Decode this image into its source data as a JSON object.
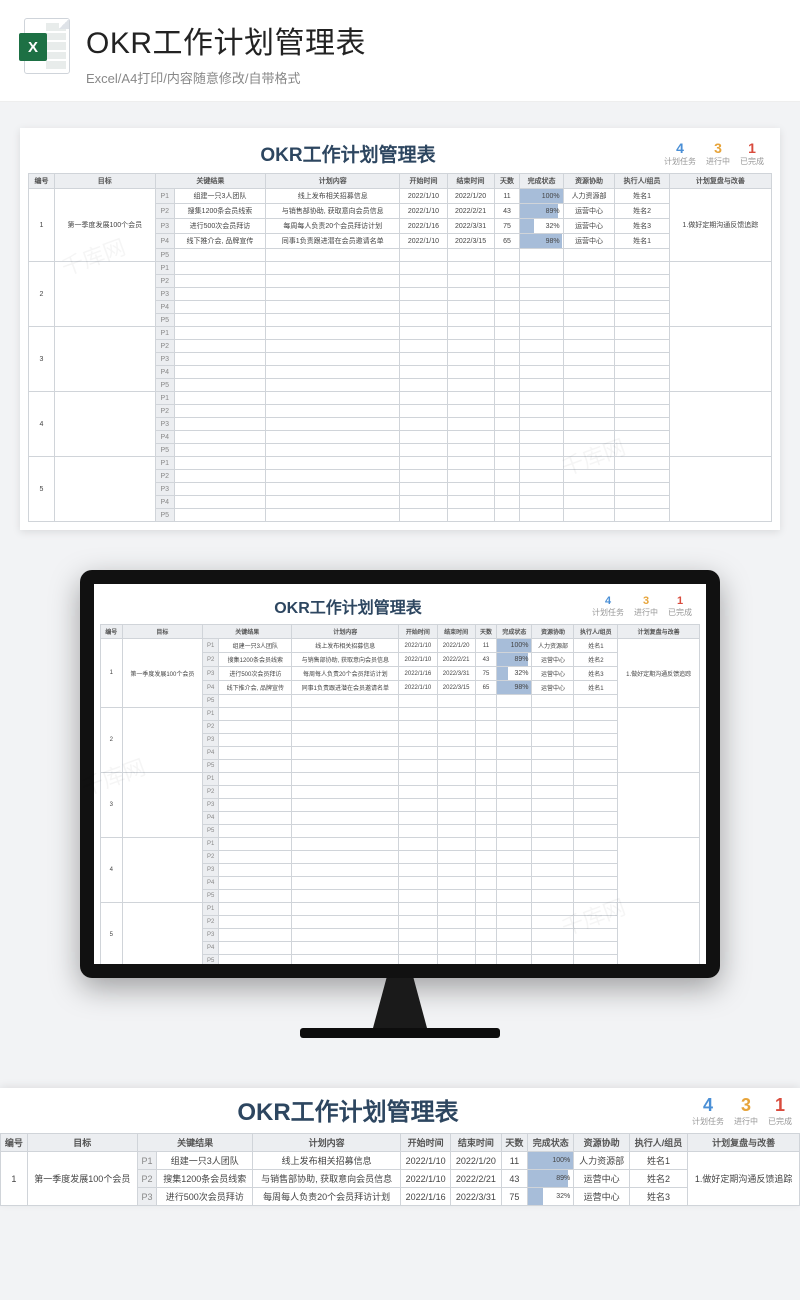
{
  "header": {
    "title": "OKR工作计划管理表",
    "subtitle": "Excel/A4打印/内容随意修改/自带格式",
    "icon_letter": "X"
  },
  "watermark": "千库网",
  "sheet": {
    "title": "OKR工作计划管理表",
    "stats": [
      {
        "num": "4",
        "label": "计划任务"
      },
      {
        "num": "3",
        "label": "进行中"
      },
      {
        "num": "1",
        "label": "已完成"
      }
    ],
    "columns": [
      "编号",
      "目标",
      "关键结果",
      "计划内容",
      "开始时间",
      "结束时间",
      "天数",
      "完成状态",
      "资源协助",
      "执行人/组员",
      "计划复盘与改善"
    ],
    "groups": [
      {
        "id": "1",
        "objective": "第一季度发展100个会员",
        "review": "1.做好定期沟通反馈追踪",
        "rows": [
          {
            "kr": "P1",
            "task": "组建一只3人团队",
            "plan": "线上发布相关招募信息",
            "start": "2022/1/10",
            "end": "2022/1/20",
            "days": "11",
            "pct": 100,
            "resource": "人力资源部",
            "owner": "姓名1"
          },
          {
            "kr": "P2",
            "task": "搜集1200条会员线索",
            "plan": "与销售部协助, 获取意向会员信息",
            "start": "2022/1/10",
            "end": "2022/2/21",
            "days": "43",
            "pct": 89,
            "resource": "运营中心",
            "owner": "姓名2"
          },
          {
            "kr": "P3",
            "task": "进行500次会员拜访",
            "plan": "每周每人负责20个会员拜访计划",
            "start": "2022/1/16",
            "end": "2022/3/31",
            "days": "75",
            "pct": 32,
            "resource": "运营中心",
            "owner": "姓名3"
          },
          {
            "kr": "P4",
            "task": "线下推介会, 品牌宣传",
            "plan": "同事1负责跟进潜在会员邀请名单",
            "start": "2022/1/10",
            "end": "2022/3/15",
            "days": "65",
            "pct": 98,
            "resource": "运营中心",
            "owner": "姓名1"
          },
          {
            "kr": "P5",
            "task": "",
            "plan": "",
            "start": "",
            "end": "",
            "days": "",
            "pct": null,
            "resource": "",
            "owner": ""
          }
        ]
      },
      {
        "id": "2",
        "objective": "",
        "review": "",
        "rows": [
          {
            "kr": "P1",
            "task": "",
            "plan": "",
            "start": "",
            "end": "",
            "days": "",
            "pct": null,
            "resource": "",
            "owner": ""
          },
          {
            "kr": "P2",
            "task": "",
            "plan": "",
            "start": "",
            "end": "",
            "days": "",
            "pct": null,
            "resource": "",
            "owner": ""
          },
          {
            "kr": "P3",
            "task": "",
            "plan": "",
            "start": "",
            "end": "",
            "days": "",
            "pct": null,
            "resource": "",
            "owner": ""
          },
          {
            "kr": "P4",
            "task": "",
            "plan": "",
            "start": "",
            "end": "",
            "days": "",
            "pct": null,
            "resource": "",
            "owner": ""
          },
          {
            "kr": "P5",
            "task": "",
            "plan": "",
            "start": "",
            "end": "",
            "days": "",
            "pct": null,
            "resource": "",
            "owner": ""
          }
        ]
      },
      {
        "id": "3",
        "objective": "",
        "review": "",
        "rows": [
          {
            "kr": "P1",
            "task": "",
            "plan": "",
            "start": "",
            "end": "",
            "days": "",
            "pct": null,
            "resource": "",
            "owner": ""
          },
          {
            "kr": "P2",
            "task": "",
            "plan": "",
            "start": "",
            "end": "",
            "days": "",
            "pct": null,
            "resource": "",
            "owner": ""
          },
          {
            "kr": "P3",
            "task": "",
            "plan": "",
            "start": "",
            "end": "",
            "days": "",
            "pct": null,
            "resource": "",
            "owner": ""
          },
          {
            "kr": "P4",
            "task": "",
            "plan": "",
            "start": "",
            "end": "",
            "days": "",
            "pct": null,
            "resource": "",
            "owner": ""
          },
          {
            "kr": "P5",
            "task": "",
            "plan": "",
            "start": "",
            "end": "",
            "days": "",
            "pct": null,
            "resource": "",
            "owner": ""
          }
        ]
      },
      {
        "id": "4",
        "objective": "",
        "review": "",
        "rows": [
          {
            "kr": "P1",
            "task": "",
            "plan": "",
            "start": "",
            "end": "",
            "days": "",
            "pct": null,
            "resource": "",
            "owner": ""
          },
          {
            "kr": "P2",
            "task": "",
            "plan": "",
            "start": "",
            "end": "",
            "days": "",
            "pct": null,
            "resource": "",
            "owner": ""
          },
          {
            "kr": "P3",
            "task": "",
            "plan": "",
            "start": "",
            "end": "",
            "days": "",
            "pct": null,
            "resource": "",
            "owner": ""
          },
          {
            "kr": "P4",
            "task": "",
            "plan": "",
            "start": "",
            "end": "",
            "days": "",
            "pct": null,
            "resource": "",
            "owner": ""
          },
          {
            "kr": "P5",
            "task": "",
            "plan": "",
            "start": "",
            "end": "",
            "days": "",
            "pct": null,
            "resource": "",
            "owner": ""
          }
        ]
      },
      {
        "id": "5",
        "objective": "",
        "review": "",
        "rows": [
          {
            "kr": "P1",
            "task": "",
            "plan": "",
            "start": "",
            "end": "",
            "days": "",
            "pct": null,
            "resource": "",
            "owner": ""
          },
          {
            "kr": "P2",
            "task": "",
            "plan": "",
            "start": "",
            "end": "",
            "days": "",
            "pct": null,
            "resource": "",
            "owner": ""
          },
          {
            "kr": "P3",
            "task": "",
            "plan": "",
            "start": "",
            "end": "",
            "days": "",
            "pct": null,
            "resource": "",
            "owner": ""
          },
          {
            "kr": "P4",
            "task": "",
            "plan": "",
            "start": "",
            "end": "",
            "days": "",
            "pct": null,
            "resource": "",
            "owner": ""
          },
          {
            "kr": "P5",
            "task": "",
            "plan": "",
            "start": "",
            "end": "",
            "days": "",
            "pct": null,
            "resource": "",
            "owner": ""
          }
        ]
      }
    ]
  },
  "bottom_crop_rows": 3,
  "chart_data": {
    "type": "table",
    "title": "OKR工作计划管理表",
    "summary": {
      "计划任务": 4,
      "进行中": 3,
      "已完成": 1
    },
    "columns": [
      "编号",
      "目标",
      "关键结果",
      "计划内容",
      "开始时间",
      "结束时间",
      "天数",
      "完成状态(%)",
      "资源协助",
      "执行人/组员",
      "计划复盘与改善"
    ],
    "rows": [
      [
        1,
        "第一季度发展100个会员",
        "P1 组建一只3人团队",
        "线上发布相关招募信息",
        "2022/1/10",
        "2022/1/20",
        11,
        100,
        "人力资源部",
        "姓名1",
        "1.做好定期沟通反馈追踪"
      ],
      [
        1,
        "第一季度发展100个会员",
        "P2 搜集1200条会员线索",
        "与销售部协助, 获取意向会员信息",
        "2022/1/10",
        "2022/2/21",
        43,
        89,
        "运营中心",
        "姓名2",
        "1.做好定期沟通反馈追踪"
      ],
      [
        1,
        "第一季度发展100个会员",
        "P3 进行500次会员拜访",
        "每周每人负责20个会员拜访计划",
        "2022/1/16",
        "2022/3/31",
        75,
        32,
        "运营中心",
        "姓名3",
        "1.做好定期沟通反馈追踪"
      ],
      [
        1,
        "第一季度发展100个会员",
        "P4 线下推介会, 品牌宣传",
        "同事1负责跟进潜在会员邀请名单",
        "2022/1/10",
        "2022/3/15",
        65,
        98,
        "运营中心",
        "姓名1",
        "1.做好定期沟通反馈追踪"
      ]
    ]
  }
}
